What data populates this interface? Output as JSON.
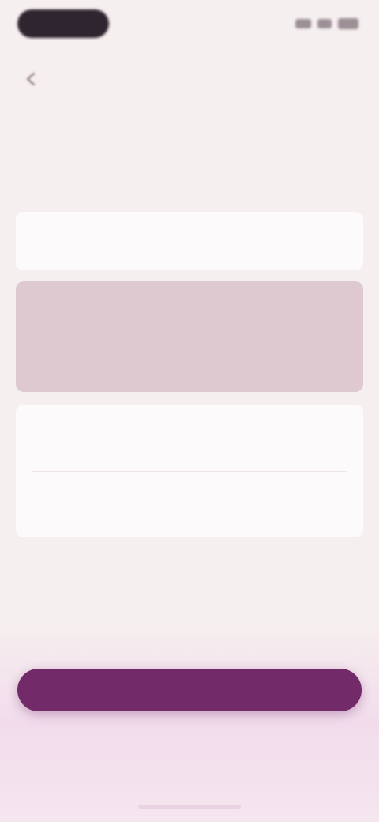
{
  "status_bar": {
    "pill_text": "",
    "icons": [
      "signal-icon",
      "wifi-icon",
      "battery-icon"
    ]
  },
  "header": {
    "title": "",
    "back_icon": "back-arrow-icon"
  },
  "section": {
    "title": "",
    "description": ""
  },
  "fields": [
    {
      "label": "",
      "value": ""
    },
    {
      "label": "",
      "value": ""
    },
    {
      "label": "",
      "value": ""
    },
    {
      "label": "",
      "value": ""
    }
  ],
  "actions": {
    "primary_label": "",
    "secondary_label": ""
  },
  "colors": {
    "background": "#f6efef",
    "accent": "#722a69",
    "selected_field": "#ddc9cf"
  }
}
